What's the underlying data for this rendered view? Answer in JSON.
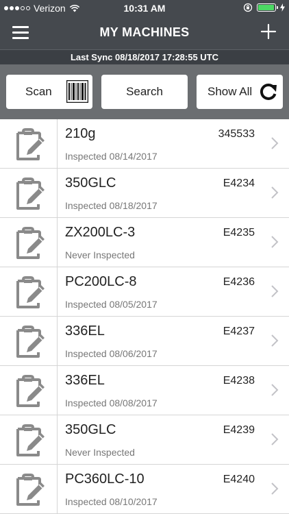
{
  "status_bar": {
    "carrier": "Verizon",
    "time": "10:31 AM",
    "signal_bars_filled": 3,
    "signal_bars_total": 5,
    "battery_level": 0.95
  },
  "header": {
    "title": "MY MACHINES",
    "menu_icon": "hamburger-menu-icon",
    "add_icon": "plus-icon"
  },
  "sync": {
    "text": "Last Sync 08/18/2017 17:28:55 UTC"
  },
  "toolbar": {
    "scan_label": "Scan",
    "search_label": "Search",
    "show_all_label": "Show All"
  },
  "machines": [
    {
      "name": "210g",
      "serial": "345533",
      "inspected": "Inspected 08/14/2017"
    },
    {
      "name": "350GLC",
      "serial": "E4234",
      "inspected": "Inspected 08/18/2017"
    },
    {
      "name": "ZX200LC-3",
      "serial": "E4235",
      "inspected": "Never Inspected"
    },
    {
      "name": "PC200LC-8",
      "serial": "E4236",
      "inspected": "Inspected 08/05/2017"
    },
    {
      "name": "336EL",
      "serial": "E4237",
      "inspected": "Inspected 08/06/2017"
    },
    {
      "name": "336EL",
      "serial": "E4238",
      "inspected": "Inspected 08/08/2017"
    },
    {
      "name": "350GLC",
      "serial": "E4239",
      "inspected": "Never Inspected"
    },
    {
      "name": "PC360LC-10",
      "serial": "E4240",
      "inspected": "Inspected 08/10/2017"
    }
  ],
  "colors": {
    "header_bg": "#45494e",
    "toolbar_bg": "#6b6e71",
    "icon_gray": "#8a8a8a",
    "battery_green": "#4cd964"
  }
}
